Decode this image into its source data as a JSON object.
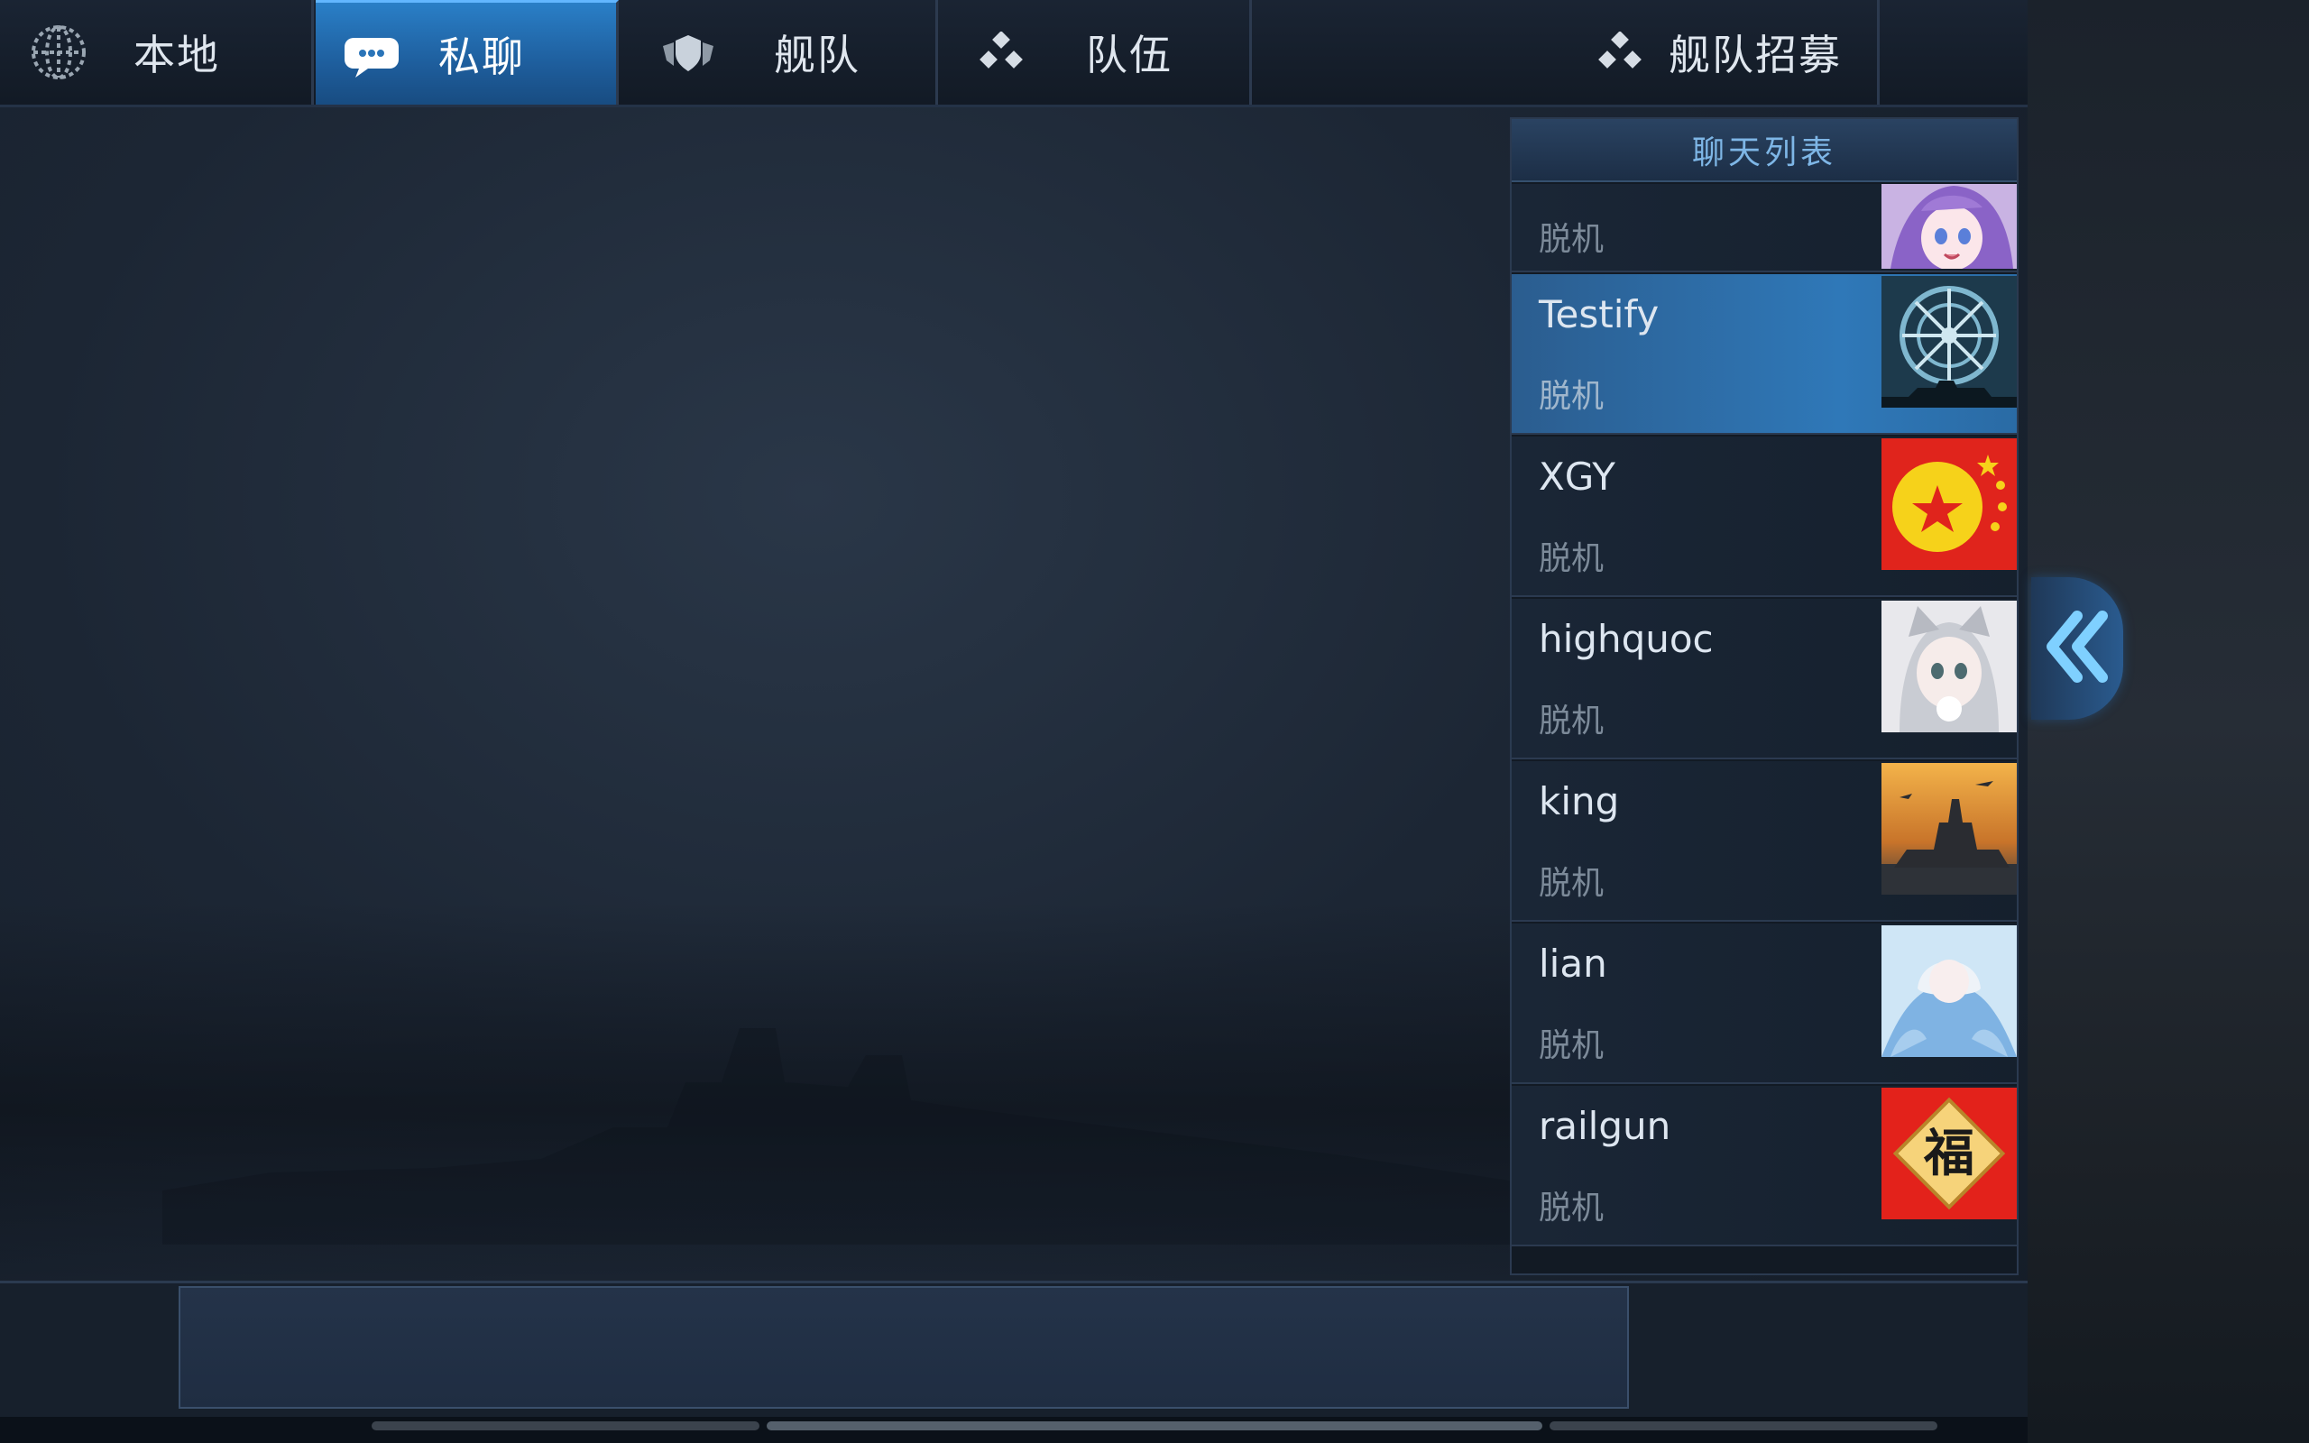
{
  "tabs": [
    {
      "id": "local",
      "label": "本地",
      "icon": "globe-icon",
      "active": false
    },
    {
      "id": "private",
      "label": "私聊",
      "icon": "chat-bubbles-icon",
      "active": true
    },
    {
      "id": "fleet",
      "label": "舰队",
      "icon": "shield-wings-icon",
      "active": false
    },
    {
      "id": "team",
      "label": "队伍",
      "icon": "dots-cluster-icon",
      "active": false
    },
    {
      "id": "recruit",
      "label": "舰队招募",
      "icon": "dots-cluster-icon",
      "active": false
    }
  ],
  "chat_list": {
    "title": "聊天列表",
    "items": [
      {
        "name": "",
        "status": "脱机",
        "avatar": "anime-girl-purple-avatar"
      },
      {
        "name": "Testify",
        "status": "脱机",
        "avatar": "ship-wheel-avatar",
        "selected": true
      },
      {
        "name": "XGY",
        "status": "脱机",
        "avatar": "china-flag-avatar"
      },
      {
        "name": "highquoc",
        "status": "脱机",
        "avatar": "anime-girl-cat-ears-avatar"
      },
      {
        "name": "king",
        "status": "脱机",
        "avatar": "battleship-avatar"
      },
      {
        "name": "lian",
        "status": "脱机",
        "avatar": "anime-girl-blue-avatar"
      },
      {
        "name": "railgun",
        "status": "脱机",
        "avatar": "fu-character-avatar",
        "avatar_text": "福"
      }
    ]
  },
  "collapse_button": {
    "icon": "double-chevron-left-icon"
  },
  "colors": {
    "accent": "#2a7fc7",
    "panel": "#1c2634",
    "selected": "#2f78b8",
    "offline": "#7c8a99"
  }
}
